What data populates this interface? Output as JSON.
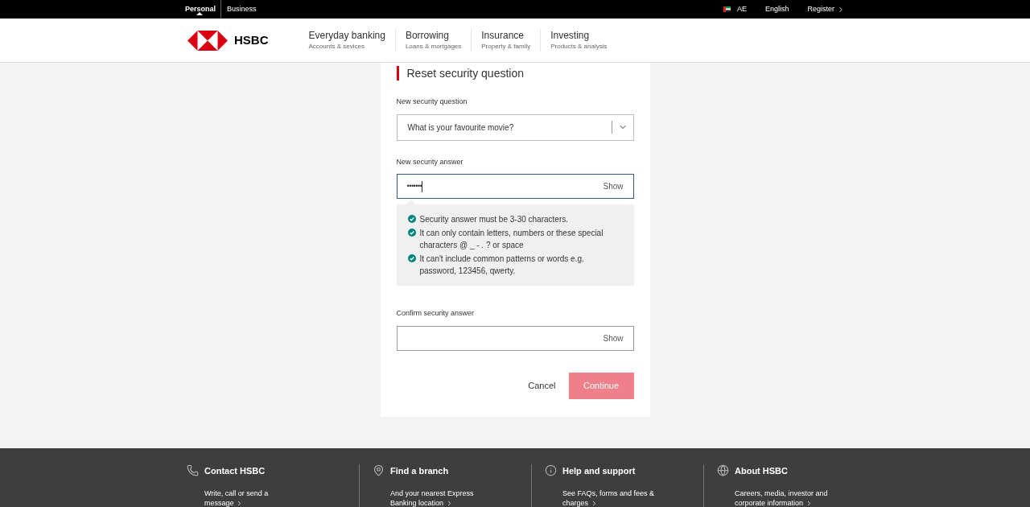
{
  "top_bar": {
    "segments": [
      {
        "label": "Personal",
        "selected": true
      },
      {
        "label": "Business",
        "selected": false
      }
    ],
    "country": "AE",
    "language": "English",
    "register": "Register"
  },
  "header": {
    "logo_text": "HSBC",
    "nav": [
      {
        "title": "Everyday banking",
        "subtitle": "Accounts & sevices"
      },
      {
        "title": "Borrowing",
        "subtitle": "Loans & mortgages"
      },
      {
        "title": "Insurance",
        "subtitle": "Property & family"
      },
      {
        "title": "Investing",
        "subtitle": "Products & analysis"
      }
    ]
  },
  "form": {
    "title": "Reset security question",
    "question": {
      "label": "New security question",
      "value": "What is your favourite movie?"
    },
    "answer": {
      "label": "New security answer",
      "value": "•••••••",
      "focused": true,
      "toggle": "Show"
    },
    "rules": [
      {
        "text": "Security answer must be 3-30 characters.",
        "met": true
      },
      {
        "text": "It can only contain letters, numbers or these special characters @ _ - . ? or space",
        "met": true
      },
      {
        "text": "It can't include common patterns or words e.g. password, 123456, qwerty.",
        "met": true
      }
    ],
    "confirm": {
      "label": "Confirm security answer",
      "focused": false,
      "toggle": "Show"
    },
    "cancel": "Cancel",
    "continue": {
      "label": "Continue",
      "disabled": true
    }
  },
  "footer": [
    {
      "kind": "phone",
      "title": "Contact HSBC",
      "link": "Write, call or send a message"
    },
    {
      "kind": "pin",
      "title": "Find a branch",
      "link": "And your nearest Express Banking location"
    },
    {
      "kind": "info",
      "title": "Help and support",
      "link": "See FAQs, forms and fees & charges"
    },
    {
      "kind": "globe",
      "title": "About HSBC",
      "link": "Careers, media, investor and corporate information"
    }
  ]
}
